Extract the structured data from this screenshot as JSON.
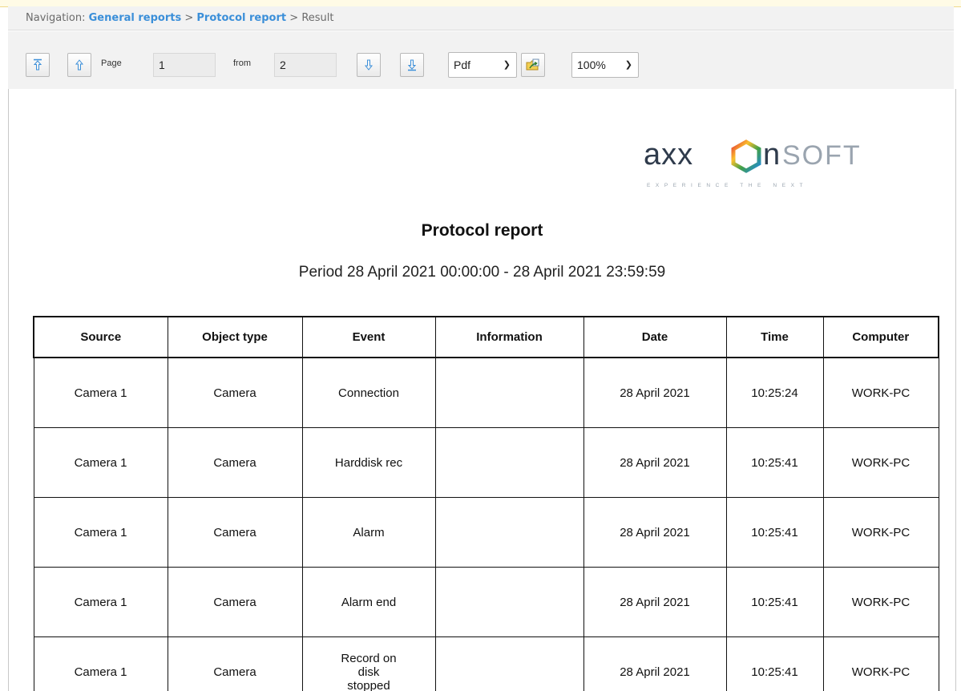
{
  "navigation": {
    "prefix": "Navigation:",
    "crumbs": [
      "General reports",
      "Protocol report"
    ],
    "separator": ">",
    "current": "Result"
  },
  "toolbar": {
    "first_icon": "first-page-icon",
    "prev_icon": "prev-page-icon",
    "page_label": "Page",
    "page_value": "1",
    "from_label": "from",
    "total_value": "2",
    "next_icon": "next-page-icon",
    "last_icon": "last-page-icon",
    "format_value": "Pdf",
    "export_icon": "export-icon",
    "zoom_value": "100%"
  },
  "report": {
    "logo_text": "axxonsoft",
    "logo_tagline": "EXPERIENCE THE NEXT",
    "title": "Protocol report",
    "period": "Period 28 April 2021 00:00:00 - 28 April 2021 23:59:59",
    "columns": [
      "Source",
      "Object type",
      "Event",
      "Information",
      "Date",
      "Time",
      "Computer"
    ],
    "rows": [
      [
        "Camera 1",
        "Camera",
        "Connection",
        "",
        "28 April 2021",
        "10:25:24",
        "WORK-PC"
      ],
      [
        "Camera 1",
        "Camera",
        "Harddisk rec",
        "",
        "28 April 2021",
        "10:25:41",
        "WORK-PC"
      ],
      [
        "Camera 1",
        "Camera",
        "Alarm",
        "",
        "28 April 2021",
        "10:25:41",
        "WORK-PC"
      ],
      [
        "Camera 1",
        "Camera",
        "Alarm end",
        "",
        "28 April 2021",
        "10:25:41",
        "WORK-PC"
      ],
      [
        "Camera 1",
        "Camera",
        "Record on disk stopped",
        "",
        "28 April 2021",
        "10:25:41",
        "WORK-PC"
      ]
    ]
  },
  "colors": {
    "link": "#3b8fd9",
    "toolbar_bg": "#f2f2f2",
    "arrow_icon": "#3b8fd9"
  }
}
